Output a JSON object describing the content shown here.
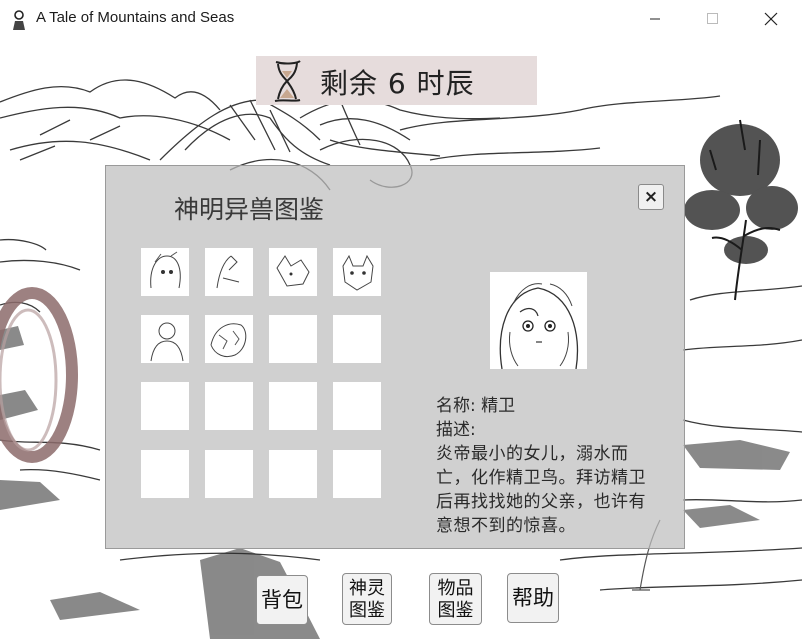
{
  "window": {
    "title": "A Tale of Mountains and Seas",
    "icons": {
      "app": "figure-icon",
      "minimize": "minimize-icon",
      "maximize": "maximize-icon",
      "close": "close-icon"
    }
  },
  "hud": {
    "time_remaining": "剩余 6 时辰",
    "icon": "hourglass-icon"
  },
  "bestiary": {
    "title": "神明异兽图鉴",
    "close_label": "×",
    "slots": [
      {
        "filled": true,
        "label": "fairy-girl"
      },
      {
        "filled": true,
        "label": "bird-sketch"
      },
      {
        "filled": true,
        "label": "fox-beast"
      },
      {
        "filled": true,
        "label": "wolf-beast"
      },
      {
        "filled": true,
        "label": "robed-figure"
      },
      {
        "filled": true,
        "label": "creature-sketch"
      },
      {
        "filled": false
      },
      {
        "filled": false
      },
      {
        "filled": false
      },
      {
        "filled": false
      },
      {
        "filled": false
      },
      {
        "filled": false
      },
      {
        "filled": false
      },
      {
        "filled": false
      },
      {
        "filled": false
      },
      {
        "filled": false
      }
    ],
    "selected": {
      "name_line": "名称: 精卫",
      "desc_label": "描述:",
      "description": "炎帝最小的女儿，溺水而亡，化作精卫鸟。拜访精卫后再找找她的父亲，也许有意想不到的惊喜。"
    }
  },
  "buttons": {
    "bag": "背包",
    "gods_line1": "神灵",
    "gods_line2": "图鉴",
    "items_line1": "物品",
    "items_line2": "图鉴",
    "help": "帮助"
  },
  "colors": {
    "panel_bg": "#bebebe",
    "banner_bg": "#e6dcdc",
    "ring": "#8c6b6b"
  }
}
